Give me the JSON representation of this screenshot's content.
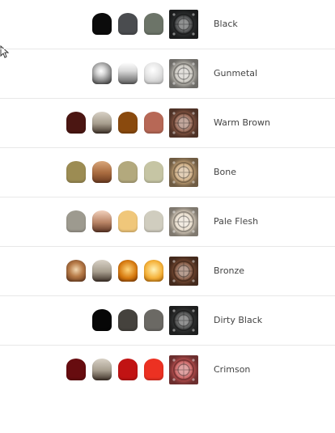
{
  "colours": [
    {
      "label": "Black",
      "pots": [
        "#0b0b0b",
        "#4a4c4f",
        "#6c7468"
      ],
      "tile": "#2f3132"
    },
    {
      "label": "Gunmetal",
      "pots": [
        "gunmetal",
        "chrome",
        "silver"
      ],
      "tile": "#c8c5bd"
    },
    {
      "label": "Warm Brown",
      "pots": [
        "#4b1612",
        "grad-taupe",
        "#8a4a0e",
        "#b76856"
      ],
      "tile": "#8d5a46"
    },
    {
      "label": "Bone",
      "pots": [
        "#9c8c53",
        "copper",
        "#b3a97d",
        "#c6c5a4"
      ],
      "tile": "#caa77a"
    },
    {
      "label": "Pale Flesh",
      "pots": [
        "#9d9a8f",
        "rustgrad",
        "#f0c77a",
        "#d0cdbf"
      ],
      "tile": "#e7dbc9"
    },
    {
      "label": "Bronze",
      "pots": [
        "bronze-met",
        "grad-taupe",
        "orange-met",
        "gold-met"
      ],
      "tile": "#7a4b33"
    },
    {
      "label": "Dirty Black",
      "pots": [
        "#070707",
        "#45423d",
        "#6b6964"
      ],
      "tile": "#353636"
    },
    {
      "label": "Crimson",
      "pots": [
        "#670c0f",
        "grad-taupe",
        "#c11313",
        "#ec3122"
      ],
      "tile": "#c45353"
    }
  ]
}
